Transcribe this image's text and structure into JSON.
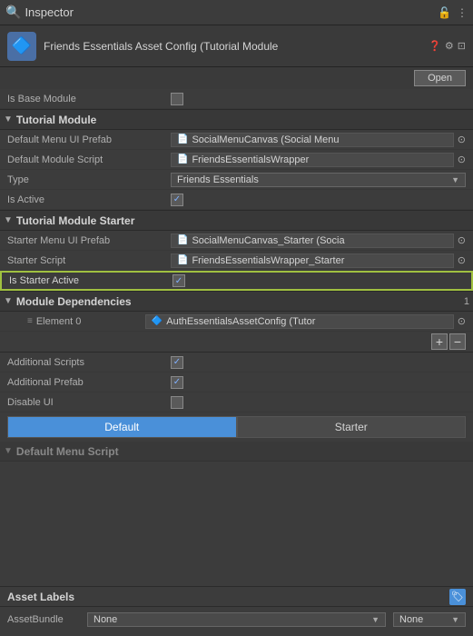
{
  "header": {
    "title": "Inspector",
    "icon": "🔍"
  },
  "asset": {
    "name": "Friends Essentials Asset Config (Tutorial Module",
    "open_label": "Open"
  },
  "fields": {
    "is_base_module": "Is Base Module",
    "tutorial_module": "Tutorial Module",
    "default_menu_ui_prefab": "Default Menu UI Prefab",
    "default_menu_ui_prefab_value": "SocialMenuCanvas (Social Menu",
    "default_module_script": "Default Module Script",
    "default_module_script_value": "FriendsEssentialsWrapper",
    "type": "Type",
    "type_value": "Friends Essentials",
    "is_active": "Is Active",
    "tutorial_module_starter": "Tutorial Module Starter",
    "starter_menu_ui_prefab": "Starter Menu UI Prefab",
    "starter_menu_ui_prefab_value": "SocialMenuCanvas_Starter (Socia",
    "starter_script": "Starter Script",
    "starter_script_value": "FriendsEssentialsWrapper_Starter",
    "is_starter_active": "Is Starter Active",
    "module_dependencies": "Module Dependencies",
    "module_dependencies_count": "1",
    "element_0": "Element 0",
    "element_0_value": "AuthEssentialsAssetConfig (Tutor",
    "additional_scripts": "Additional Scripts",
    "additional_prefab": "Additional Prefab",
    "disable_ui": "Disable UI",
    "tab_default": "Default",
    "tab_starter": "Starter"
  },
  "asset_labels": {
    "title": "Asset Labels",
    "asset_bundle_label": "AssetBundle",
    "bundle_none_1": "None",
    "bundle_none_2": "None"
  },
  "buttons": {
    "plus": "+",
    "minus": "−",
    "open": "Open"
  }
}
